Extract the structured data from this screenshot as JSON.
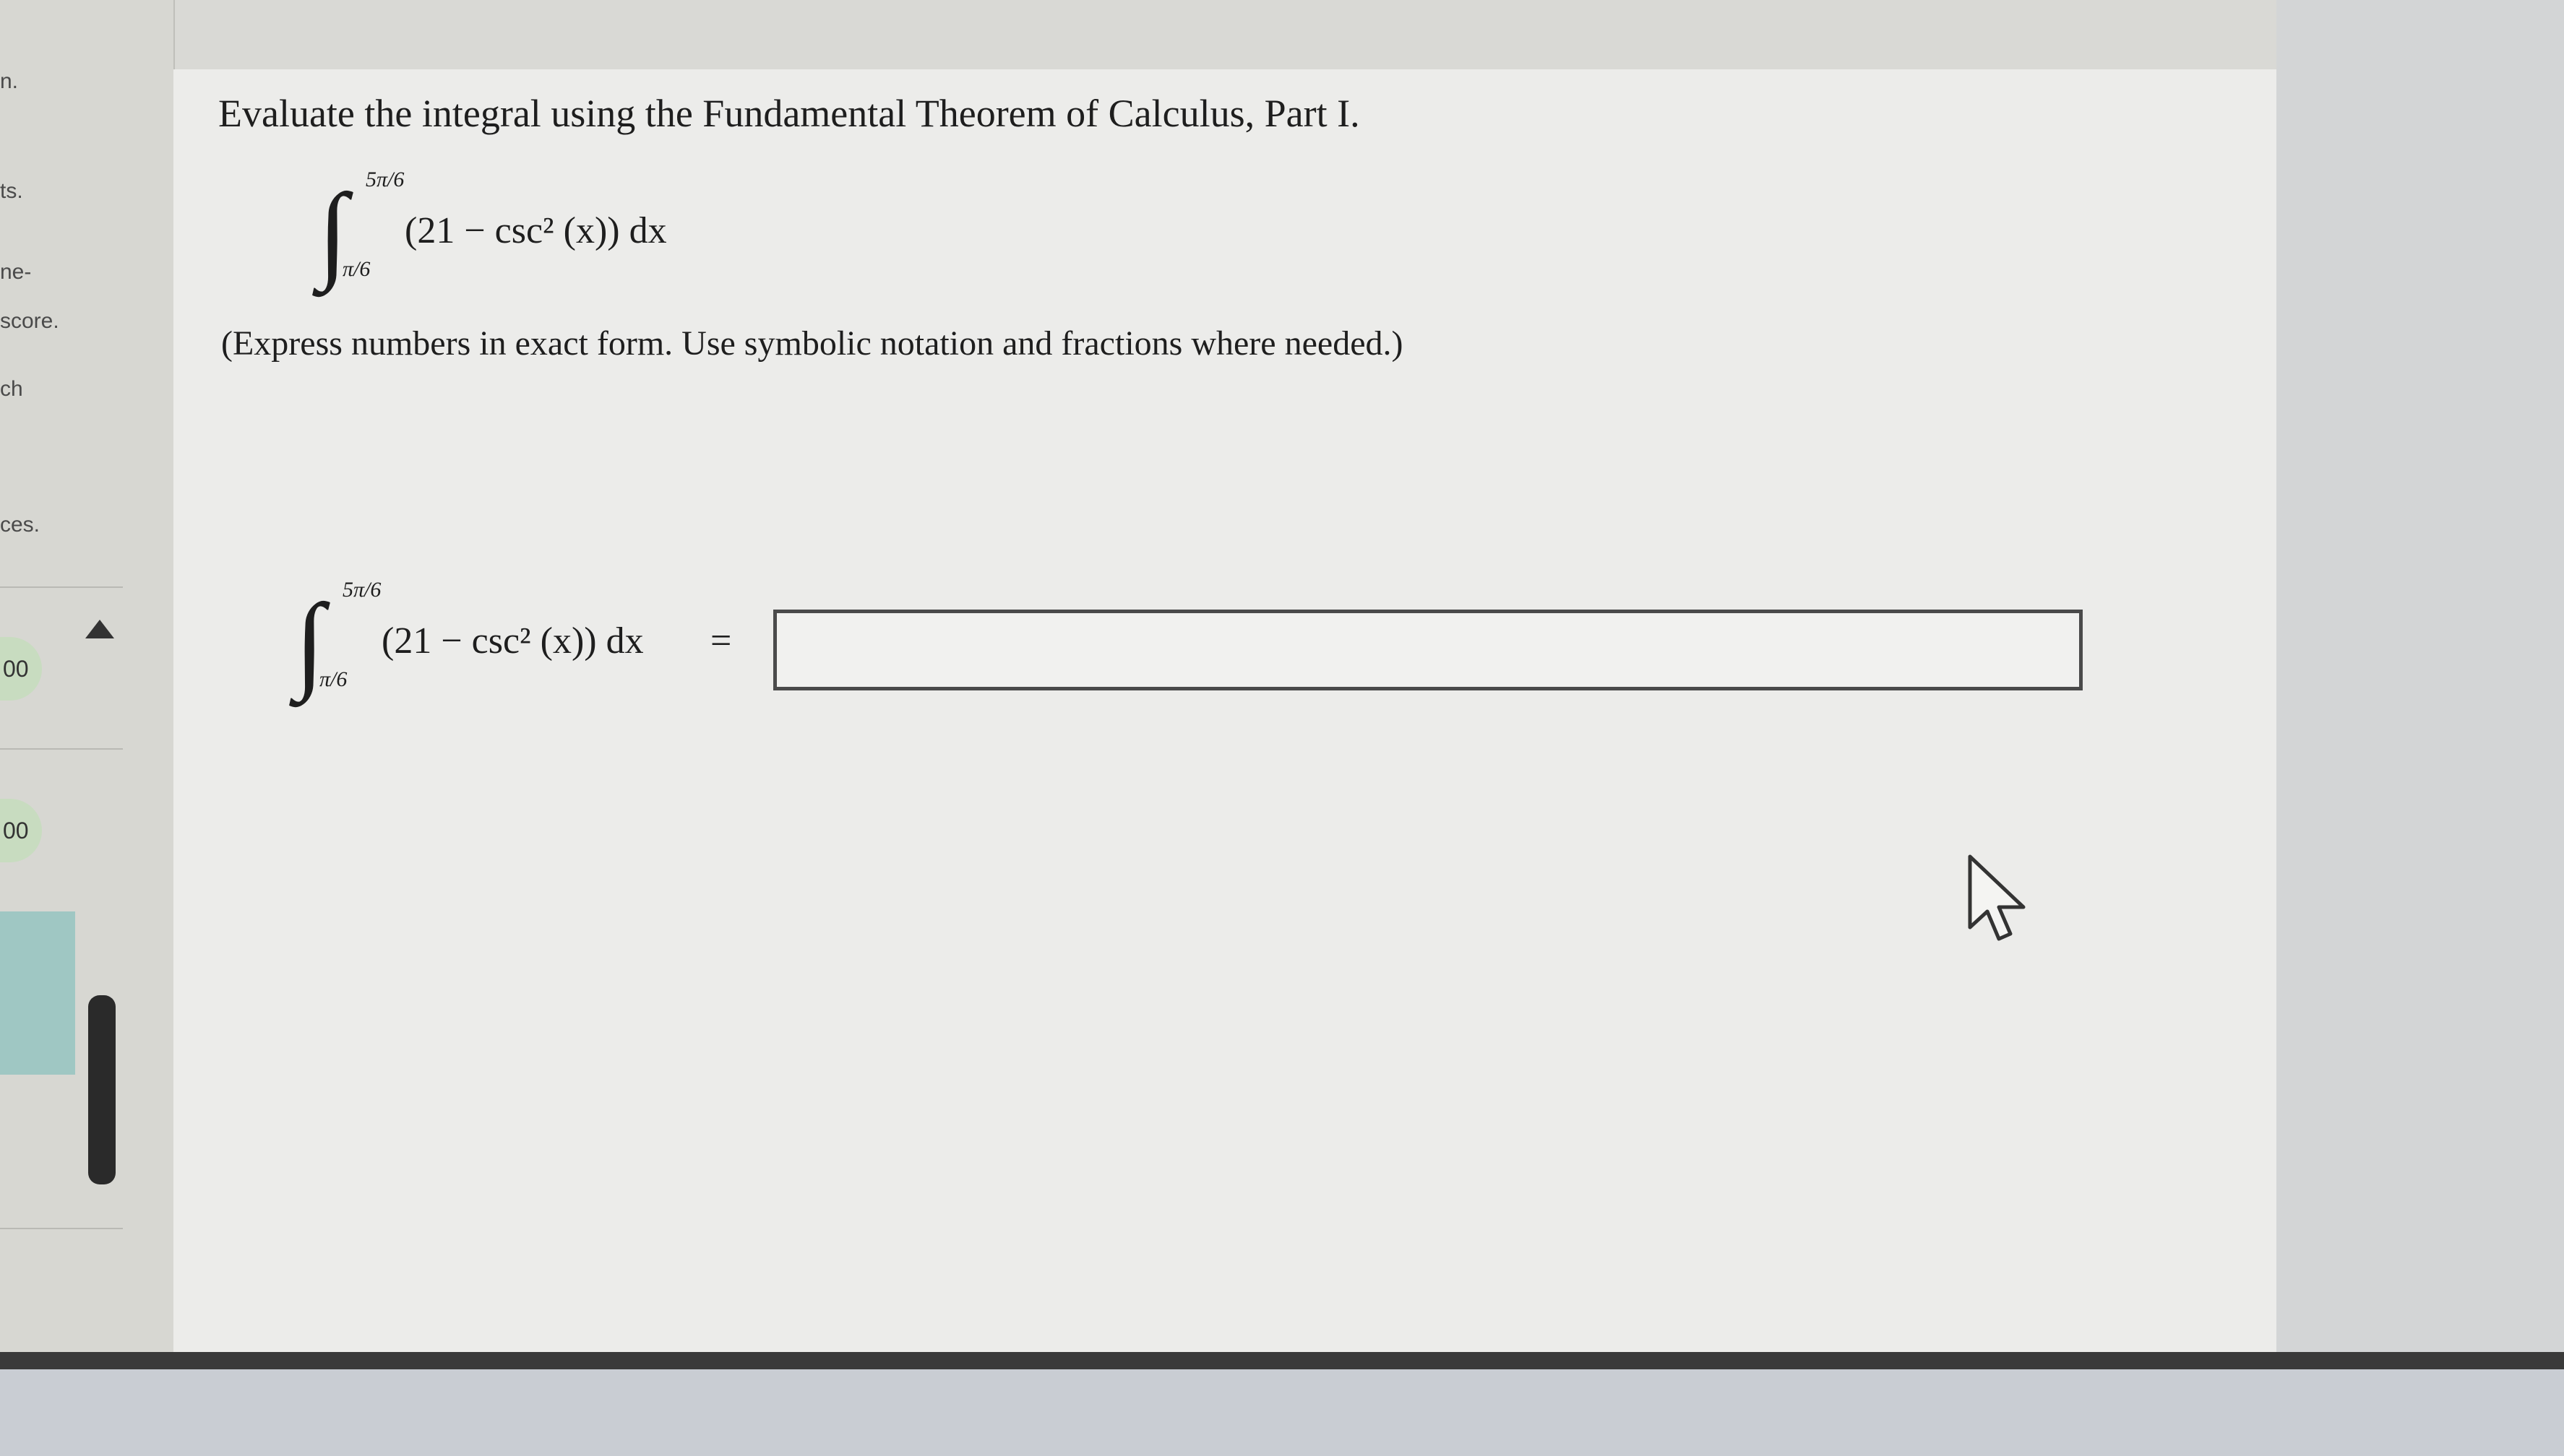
{
  "sidebar": {
    "fragments": [
      "n.",
      "ts.",
      "ne-",
      "score.",
      "ch",
      "ces."
    ],
    "scores": [
      "00",
      "00"
    ]
  },
  "question": {
    "instructions": "Evaluate the integral using the Fundamental Theorem of Calculus, Part I.",
    "integral": {
      "upper": "5π/6",
      "lower": "π/6",
      "integrand": "(21 − csc² (x)) dx"
    },
    "note": "(Express numbers in exact form. Use symbolic notation and fractions where needed.)",
    "answer": {
      "equals": "=",
      "value": ""
    }
  },
  "colors": {
    "panel": "#ececea",
    "sidebar": "#d7d7d2",
    "score_pill": "#c8dcc0",
    "teal_block": "#9fc7c3"
  }
}
